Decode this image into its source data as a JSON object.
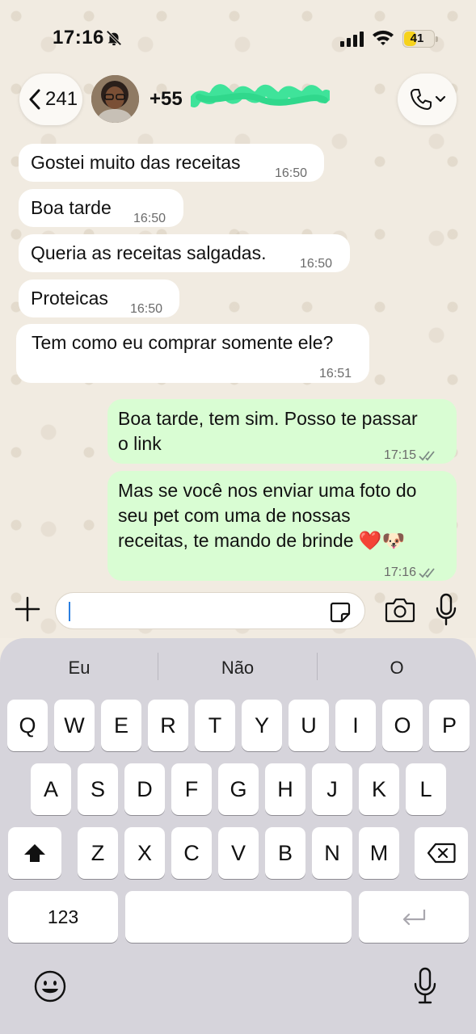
{
  "status_bar": {
    "time": "17:16",
    "battery_level": "41",
    "battery_fraction": 0.41
  },
  "header": {
    "back_count": "241",
    "contact_name": "+55"
  },
  "messages": [
    {
      "direction": "in",
      "text": "Gostei muito das receitas",
      "time": "16:50"
    },
    {
      "direction": "in",
      "text": "Boa tarde",
      "time": "16:50"
    },
    {
      "direction": "in",
      "text": "Queria as receitas salgadas.",
      "time": "16:50"
    },
    {
      "direction": "in",
      "text": "Proteicas",
      "time": "16:50"
    },
    {
      "direction": "in",
      "text": "Tem como eu comprar somente ele?",
      "time": "16:51"
    },
    {
      "direction": "out",
      "line1": "Boa tarde, tem sim. Posso te passar",
      "line2": "o link",
      "time": "17:15"
    },
    {
      "direction": "out",
      "line1": "Mas se você nos enviar uma foto do",
      "line2": "seu pet com uma de nossas",
      "line3": "receitas, te mando de brinde ❤️🐶",
      "time": "17:16"
    }
  ],
  "input": {
    "placeholder": ""
  },
  "keyboard": {
    "suggestions": [
      "Eu",
      "Não",
      "O"
    ],
    "row1": [
      "Q",
      "W",
      "E",
      "R",
      "T",
      "Y",
      "U",
      "I",
      "O",
      "P"
    ],
    "row2": [
      "A",
      "S",
      "D",
      "F",
      "G",
      "H",
      "J",
      "K",
      "L"
    ],
    "row3": [
      "Z",
      "X",
      "C",
      "V",
      "B",
      "N",
      "M"
    ],
    "numbers_label": "123"
  },
  "colors": {
    "incoming_bubble": "#ffffff",
    "outgoing_bubble": "#d9fdd3",
    "wallpaper": "#f1ebe1",
    "keyboard": "#d6d4db",
    "redaction": "#3fe39a"
  },
  "icons": [
    "bell-slash-icon",
    "cellular-signal-icon",
    "wifi-icon",
    "battery-icon",
    "chevron-left-icon",
    "phone-icon",
    "chevron-down-icon",
    "plus-icon",
    "sticker-icon",
    "camera-icon",
    "microphone-icon",
    "shift-icon",
    "backspace-icon",
    "return-icon",
    "emoji-icon"
  ]
}
